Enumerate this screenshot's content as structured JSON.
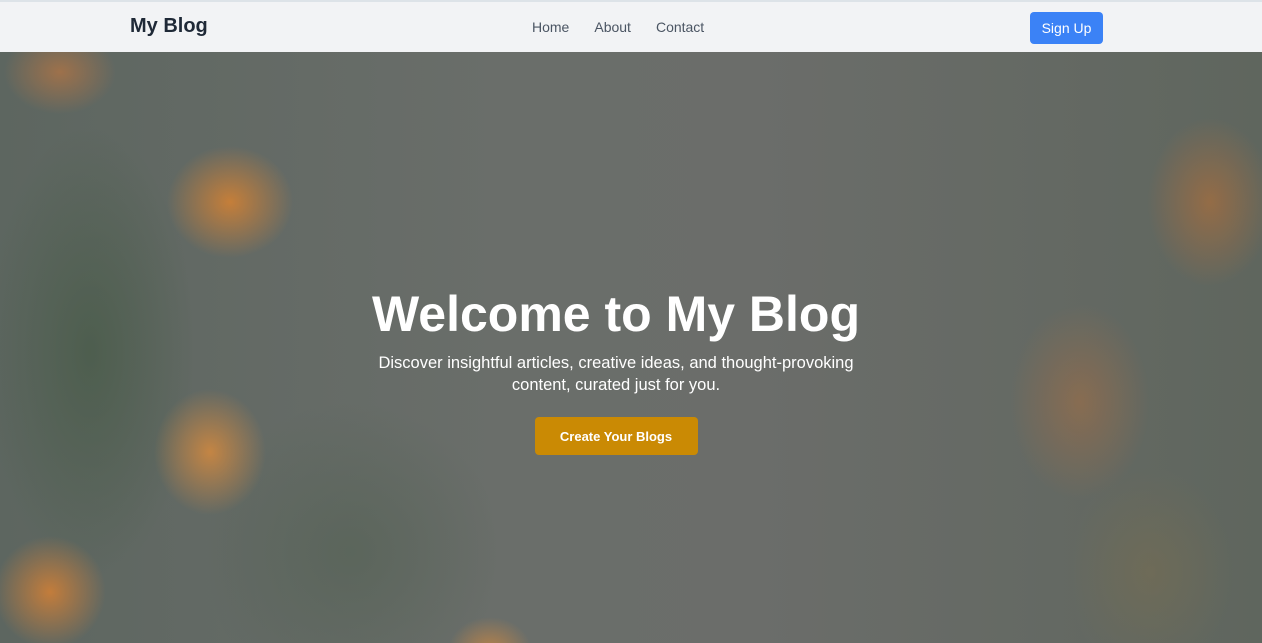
{
  "nav": {
    "logo": "My Blog",
    "links": [
      "Home",
      "About",
      "Contact"
    ],
    "signup_label": "Sign Up"
  },
  "hero": {
    "title": "Welcome to My Blog",
    "subtitle": "Discover insightful articles, creative ideas, and thought-provoking content, curated just for you.",
    "cta_label": "Create Your Blogs",
    "cta_color": "#ca8a04"
  },
  "colors": {
    "signup": "#3b82f6"
  }
}
